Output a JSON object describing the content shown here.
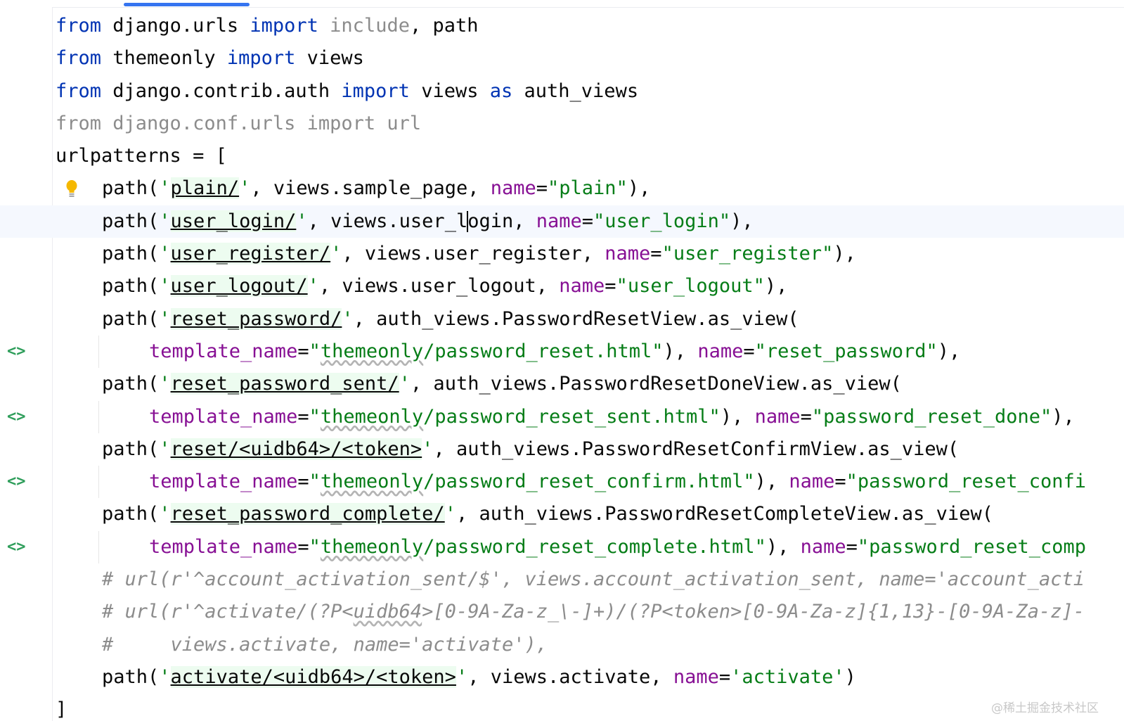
{
  "editor": {
    "watermark": "@稀土掘金技术社区",
    "colors": {
      "keyword": "#0033b3",
      "string": "#067d17",
      "param": "#871094",
      "comment": "#8c8c8c",
      "gutter_icon": "#2f9e5b"
    },
    "lines": [
      {
        "p": [
          "from",
          " django.urls ",
          "import",
          " ",
          "include",
          ", path"
        ]
      },
      {
        "p": [
          "from",
          " themeonly ",
          "import",
          " views"
        ]
      },
      {
        "p": [
          "from",
          " django.contrib.auth ",
          "import",
          " views ",
          "as",
          " auth_views"
        ]
      },
      {
        "p": [
          "from django.conf.urls import url"
        ]
      },
      {
        "p": [
          "urlpatterns = ["
        ]
      },
      {
        "p": [
          "path(",
          "'",
          "plain/",
          "'",
          ", views.sample_page, ",
          "name",
          "=",
          "\"plain\"",
          "),"
        ]
      },
      {
        "p": [
          "path(",
          "'",
          "user_login/",
          "'",
          ", views.user_l",
          "ogin, ",
          "name",
          "=",
          "\"user_login\"",
          "),"
        ]
      },
      {
        "p": [
          "path(",
          "'",
          "user_register/",
          "'",
          ", views.user_register, ",
          "name",
          "=",
          "\"user_register\"",
          "),"
        ]
      },
      {
        "p": [
          "path(",
          "'",
          "user_logout/",
          "'",
          ", views.user_logout, ",
          "name",
          "=",
          "\"user_logout\"",
          "),"
        ]
      },
      {
        "p": [
          "path(",
          "'",
          "reset_password/",
          "'",
          ", auth_views.PasswordResetView.as_view("
        ]
      },
      {
        "p": [
          "template_name",
          "=",
          "\"",
          "themeonly",
          "/password_reset.html\"",
          "), ",
          "name",
          "=",
          "\"reset_password\"",
          "),"
        ]
      },
      {
        "p": [
          "path(",
          "'",
          "reset_password_sent/",
          "'",
          ", auth_views.PasswordResetDoneView.as_view("
        ]
      },
      {
        "p": [
          "template_name",
          "=",
          "\"",
          "themeonly",
          "/password_reset_sent.html\"",
          "), ",
          "name",
          "=",
          "\"password_reset_done\"",
          "),"
        ]
      },
      {
        "p": [
          "path(",
          "'",
          "reset/<uidb64>/<token>",
          "'",
          ", auth_views.PasswordResetConfirmView.as_view("
        ]
      },
      {
        "p": [
          "template_name",
          "=",
          "\"",
          "themeonly",
          "/password_reset_confirm.html\"",
          "), ",
          "name",
          "=",
          "\"password_reset_confi"
        ]
      },
      {
        "p": [
          "path(",
          "'",
          "reset_password_complete/",
          "'",
          ", auth_views.PasswordResetCompleteView.as_view("
        ]
      },
      {
        "p": [
          "template_name",
          "=",
          "\"",
          "themeonly",
          "/password_reset_complete.html\"",
          "), ",
          "name",
          "=",
          "\"password_reset_comp"
        ]
      },
      {
        "p": [
          "# url(r'^account_activation_sent/$', views.account_activation_sent, name='account_acti"
        ]
      },
      {
        "p": [
          "# url(r'^activate/(?P<",
          "uidb64",
          ">[0-9A-Za-z_\\-]+)/(?P<token>[0-9A-Za-z]{1,13}-[0-9A-Za-z]-"
        ]
      },
      {
        "p": [
          "#     views.activate, name='activate'),"
        ]
      },
      {
        "p": [
          "path(",
          "'",
          "activate/<uidb64>/<token>",
          "'",
          ", views.activate, ",
          "name",
          "=",
          "'activate'",
          ")"
        ]
      },
      {
        "p": [
          "]"
        ]
      }
    ],
    "gutter_icons": [
      "<>",
      "<>",
      "<>",
      "<>"
    ]
  }
}
